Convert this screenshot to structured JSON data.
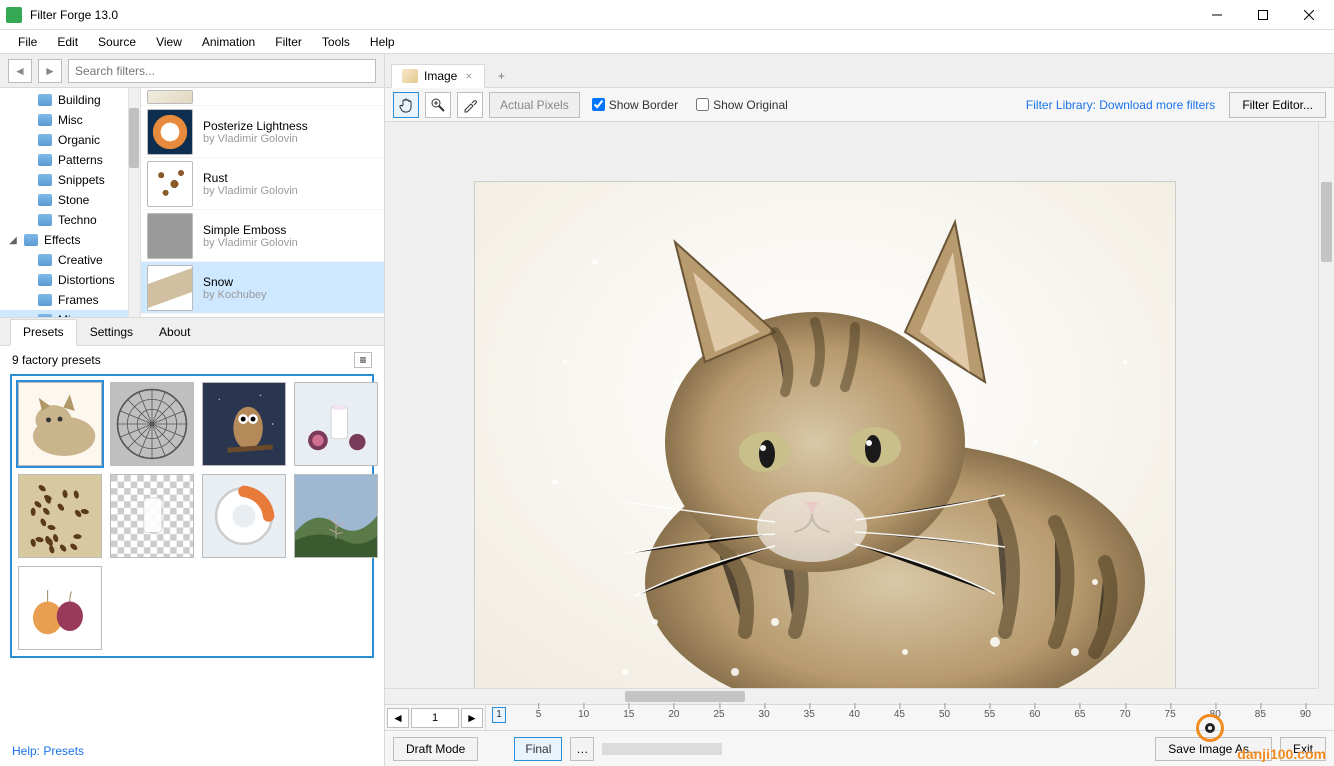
{
  "window": {
    "title": "Filter Forge 13.0"
  },
  "menu": [
    "File",
    "Edit",
    "Source",
    "View",
    "Animation",
    "Filter",
    "Tools",
    "Help"
  ],
  "search": {
    "placeholder": "Search filters..."
  },
  "tree": [
    {
      "label": "Building",
      "level": 1
    },
    {
      "label": "Misc",
      "level": 1
    },
    {
      "label": "Organic",
      "level": 1
    },
    {
      "label": "Patterns",
      "level": 1
    },
    {
      "label": "Snippets",
      "level": 1
    },
    {
      "label": "Stone",
      "level": 1
    },
    {
      "label": "Techno",
      "level": 1
    },
    {
      "label": "Effects",
      "level": 0,
      "expanded": true
    },
    {
      "label": "Creative",
      "level": 1
    },
    {
      "label": "Distortions",
      "level": 1
    },
    {
      "label": "Frames",
      "level": 1
    },
    {
      "label": "Misc",
      "level": 1,
      "selected": true
    }
  ],
  "filters": [
    {
      "name": "",
      "author": "",
      "thumb": "t-cube",
      "clipped": true
    },
    {
      "name": "Posterize Lightness",
      "author": "by Vladimir Golovin",
      "thumb": "t-post"
    },
    {
      "name": "Rust",
      "author": "by Vladimir Golovin",
      "thumb": "t-rust"
    },
    {
      "name": "Simple Emboss",
      "author": "by Vladimir Golovin",
      "thumb": "t-emboss"
    },
    {
      "name": "Snow",
      "author": "by Kochubey",
      "thumb": "t-snow",
      "selected": true
    }
  ],
  "panel_tabs": [
    "Presets",
    "Settings",
    "About"
  ],
  "presets": {
    "count_label": "9 factory presets",
    "count": 9
  },
  "help": {
    "label": "Help: Presets"
  },
  "doc_tab": {
    "label": "Image"
  },
  "toolbar": {
    "actual_pixels": "Actual Pixels",
    "show_border": "Show Border",
    "show_original": "Show Original",
    "library_link": "Filter Library: Download more filters",
    "editor_btn": "Filter Editor..."
  },
  "timeline": {
    "frame": "1",
    "marker": "1",
    "ticks": [
      "5",
      "10",
      "15",
      "20",
      "25",
      "30",
      "35",
      "40",
      "45",
      "50",
      "55",
      "60",
      "65",
      "70",
      "75",
      "80",
      "85",
      "90"
    ]
  },
  "bottom": {
    "draft": "Draft Mode",
    "final": "Final",
    "save": "Save Image As...",
    "exit": "Exit"
  },
  "watermark": "danji100.com"
}
